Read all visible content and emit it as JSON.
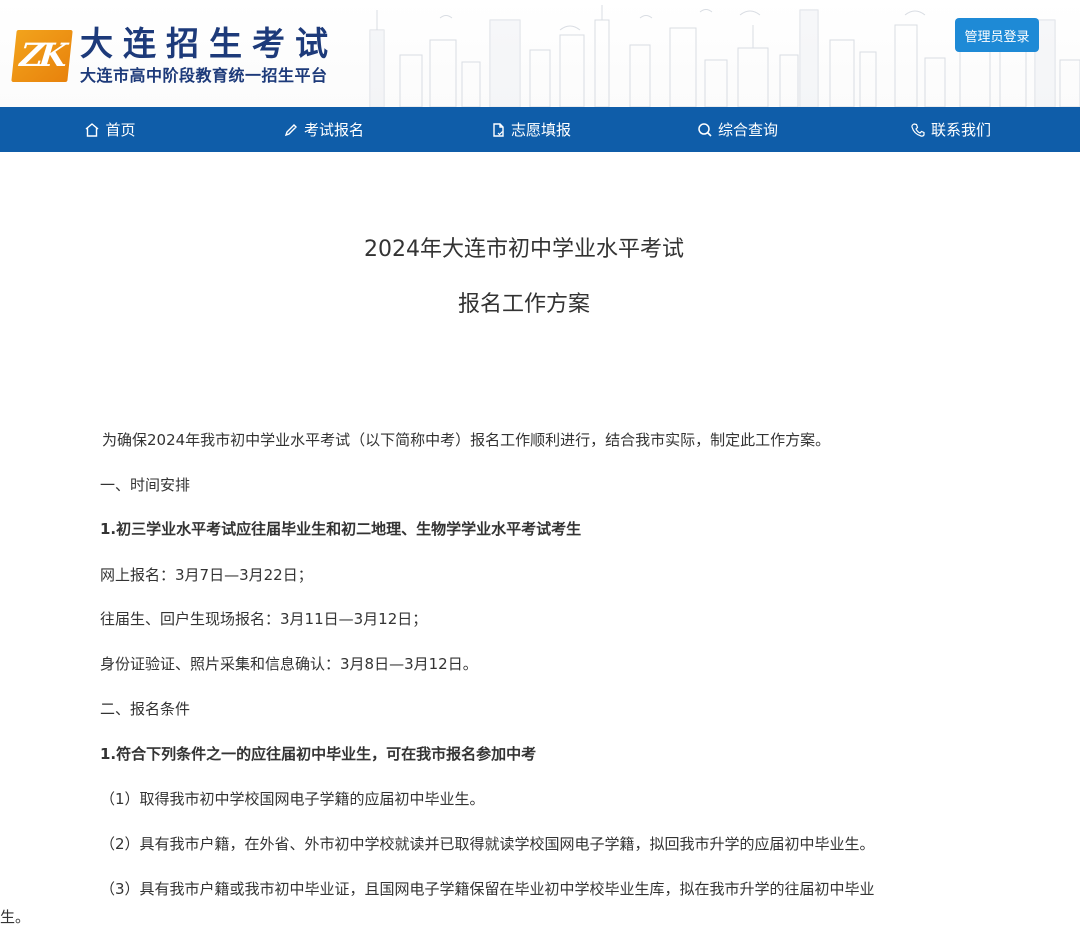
{
  "header": {
    "logo_title": "大连招生考试",
    "logo_subtitle": "大连市高中阶段教育统一招生平台",
    "admin_button": "管理员登录"
  },
  "nav": {
    "items": [
      {
        "label": "首页",
        "icon": "home-icon"
      },
      {
        "label": "考试报名",
        "icon": "pencil-icon"
      },
      {
        "label": "志愿填报",
        "icon": "document-icon"
      },
      {
        "label": "综合查询",
        "icon": "search-icon"
      },
      {
        "label": "联系我们",
        "icon": "phone-icon"
      }
    ],
    "bg_color": "#0f5da9"
  },
  "article": {
    "title_line1": "2024年大连市初中学业水平考试",
    "title_line2": "报名工作方案",
    "intro": "为确保2024年我市初中学业水平考试（以下简称中考）报名工作顺利进行，结合我市实际，制定此工作方案。",
    "section1_heading": "一、时间安排",
    "section1_sub1": "1.初三学业水平考试应往届毕业生和初二地理、生物学学业水平考试考生",
    "section1_line1": "网上报名：3月7日—3月22日；",
    "section1_line2": "往届生、回户生现场报名：3月11日—3月12日；",
    "section1_line3": "身份证验证、照片采集和信息确认：3月8日—3月12日。",
    "section2_heading": "二、报名条件",
    "section2_sub1": "1.符合下列条件之一的应往届初中毕业生，可在我市报名参加中考",
    "cond1": "（1）取得我市初中学校国网电子学籍的应届初中毕业生。",
    "cond2": "（2）具有我市户籍，在外省、外市初中学校就读并已取得就读学校国网电子学籍，拟回我市升学的应届初中毕业生。",
    "cond3_part1": "（3）具有我市户籍或我市初中毕业证，且国网电子学籍保留在毕业初中学校毕业生库，拟在我市升学的往届初中毕业",
    "cond3_part2": "生。"
  }
}
